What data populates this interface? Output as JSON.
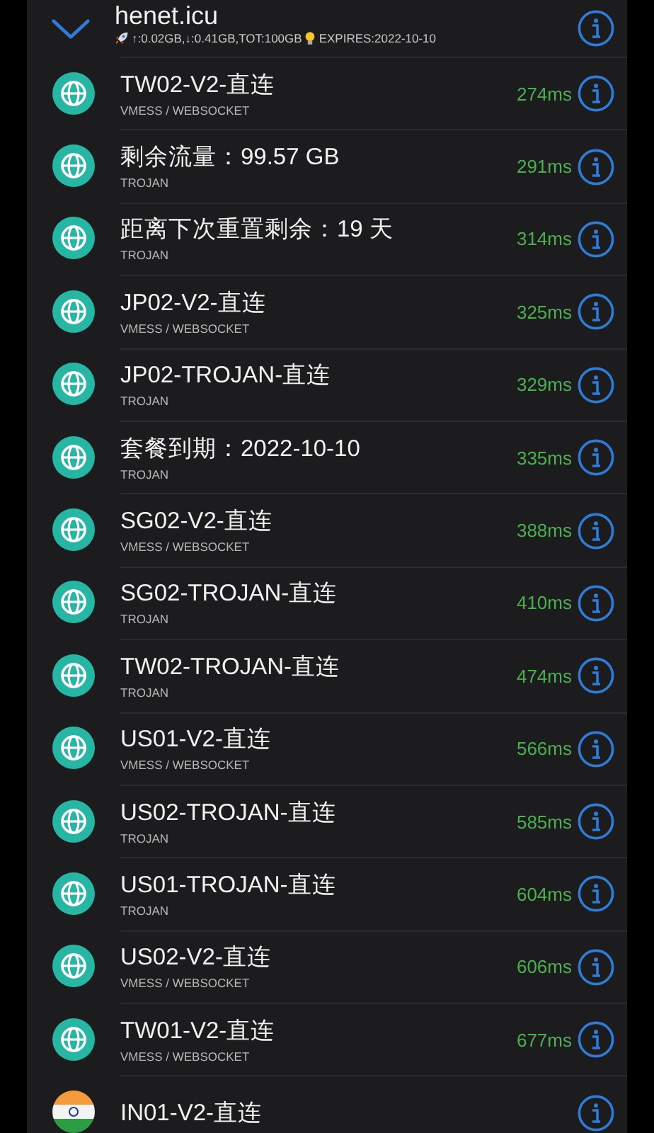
{
  "group": {
    "title": "henet.icu",
    "expanded": true,
    "traffic": "↑:0.02GB,↓:0.41GB,TOT:100GB",
    "expires": "EXPIRES:2022-10-10"
  },
  "nodes": [
    {
      "kind": "globe",
      "name": "TW02-V2-直连",
      "protocol": "VMESS / WEBSOCKET",
      "latency": "274ms"
    },
    {
      "kind": "globe",
      "name": "剩余流量：99.57 GB",
      "protocol": "TROJAN",
      "latency": "291ms"
    },
    {
      "kind": "globe",
      "name": "距离下次重置剩余：19 天",
      "protocol": "TROJAN",
      "latency": "314ms"
    },
    {
      "kind": "globe",
      "name": "JP02-V2-直连",
      "protocol": "VMESS / WEBSOCKET",
      "latency": "325ms"
    },
    {
      "kind": "globe",
      "name": "JP02-TROJAN-直连",
      "protocol": "TROJAN",
      "latency": "329ms"
    },
    {
      "kind": "globe",
      "name": "套餐到期：2022-10-10",
      "protocol": "TROJAN",
      "latency": "335ms"
    },
    {
      "kind": "globe",
      "name": "SG02-V2-直连",
      "protocol": "VMESS / WEBSOCKET",
      "latency": "388ms"
    },
    {
      "kind": "globe",
      "name": "SG02-TROJAN-直连",
      "protocol": "TROJAN",
      "latency": "410ms"
    },
    {
      "kind": "globe",
      "name": "TW02-TROJAN-直连",
      "protocol": "TROJAN",
      "latency": "474ms"
    },
    {
      "kind": "globe",
      "name": "US01-V2-直连",
      "protocol": "VMESS / WEBSOCKET",
      "latency": "566ms"
    },
    {
      "kind": "globe",
      "name": "US02-TROJAN-直连",
      "protocol": "TROJAN",
      "latency": "585ms"
    },
    {
      "kind": "globe",
      "name": "US01-TROJAN-直连",
      "protocol": "TROJAN",
      "latency": "604ms"
    },
    {
      "kind": "globe",
      "name": "US02-V2-直连",
      "protocol": "VMESS / WEBSOCKET",
      "latency": "606ms"
    },
    {
      "kind": "globe",
      "name": "TW01-V2-直连",
      "protocol": "VMESS / WEBSOCKET",
      "latency": "677ms"
    },
    {
      "kind": "flag",
      "name": "IN01-V2-直连"
    }
  ]
}
